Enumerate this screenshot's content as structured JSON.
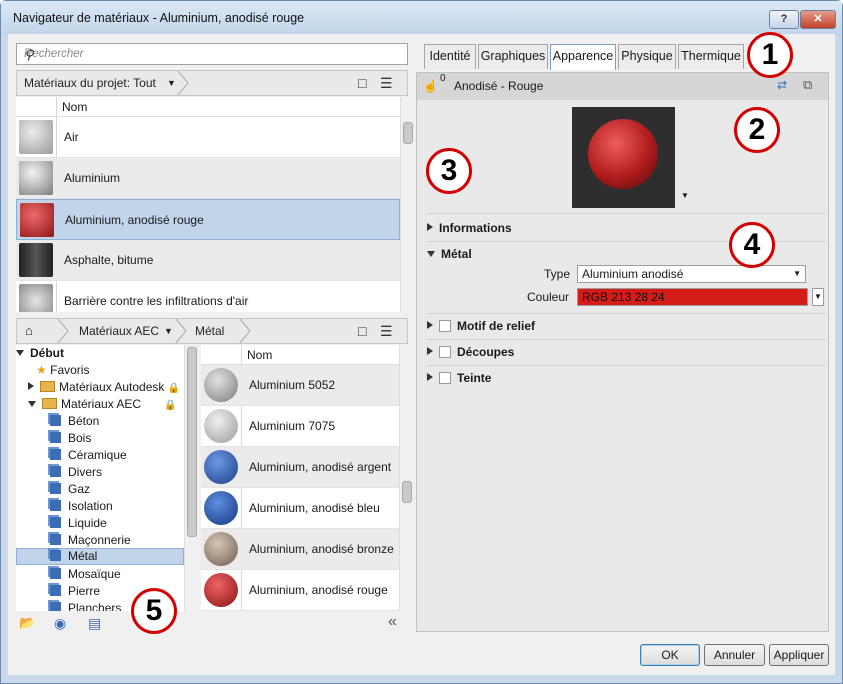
{
  "window": {
    "title": "Navigateur de matériaux - Aluminium, anodisé rouge",
    "help": "?",
    "close": "✕"
  },
  "search": {
    "placeholder": "Rechercher"
  },
  "project": {
    "filter_label": "Matériaux du projet: Tout",
    "column_name": "Nom",
    "items": [
      {
        "label": "Air",
        "color": "#b5b5b5"
      },
      {
        "label": "Aluminium",
        "color": "#9a9a9a"
      },
      {
        "label": "Aluminium, anodisé rouge",
        "color": "#c92a2a"
      },
      {
        "label": "Asphalte, bitume",
        "color": "#3a3a3a"
      },
      {
        "label": "Barrière contre les infiltrations d'air",
        "color": "#a7a7a7"
      }
    ]
  },
  "library": {
    "crumbs": [
      "Matériaux AEC",
      "Métal"
    ],
    "column_name": "Nom",
    "tree": [
      {
        "label": "Début"
      },
      {
        "label": "Favoris"
      },
      {
        "label": "Matériaux Autodesk"
      },
      {
        "label": "Matériaux AEC"
      },
      {
        "label": "Béton"
      },
      {
        "label": "Bois"
      },
      {
        "label": "Céramique"
      },
      {
        "label": "Divers"
      },
      {
        "label": "Gaz"
      },
      {
        "label": "Isolation"
      },
      {
        "label": "Liquide"
      },
      {
        "label": "Maçonnerie"
      },
      {
        "label": "Métal"
      },
      {
        "label": "Mosaïque"
      },
      {
        "label": "Pierre"
      },
      {
        "label": "Planchers"
      }
    ],
    "items": [
      {
        "label": "Aluminium 5052",
        "color": "#8e8e8e"
      },
      {
        "label": "Aluminium 7075",
        "color": "#a5a5a5"
      },
      {
        "label": "Aluminium, anodisé argent",
        "color": "#2c5fb6"
      },
      {
        "label": "Aluminium, anodisé bleu",
        "color": "#2558b2"
      },
      {
        "label": "Aluminium, anodisé bronze",
        "color": "#8f7b6b"
      },
      {
        "label": "Aluminium, anodisé rouge",
        "color": "#c62222"
      }
    ]
  },
  "tabs": [
    "Identité",
    "Graphiques",
    "Apparence",
    "Physique",
    "Thermique"
  ],
  "asset": {
    "count": "0",
    "name": "Anodisé - Rouge"
  },
  "sections": {
    "informations": "Informations",
    "metal": "Métal",
    "relief": "Motif de relief",
    "decoupes": "Découpes",
    "teinte": "Teinte"
  },
  "metal": {
    "type_label": "Type",
    "type_value": "Aluminium anodisé",
    "color_label": "Couleur",
    "color_value": "RGB 213 28 24",
    "color_hex": "#d51c18"
  },
  "buttons": {
    "ok": "OK",
    "cancel": "Annuler",
    "apply": "Appliquer"
  },
  "callouts": [
    "1",
    "2",
    "3",
    "4",
    "5"
  ]
}
